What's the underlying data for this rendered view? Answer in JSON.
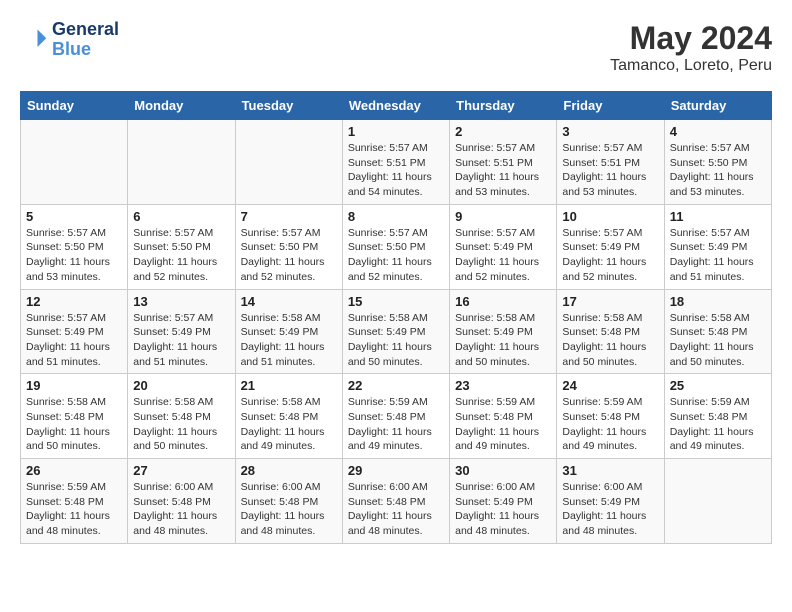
{
  "header": {
    "logo_line1": "General",
    "logo_line2": "Blue",
    "title": "May 2024",
    "subtitle": "Tamanco, Loreto, Peru"
  },
  "days_of_week": [
    "Sunday",
    "Monday",
    "Tuesday",
    "Wednesday",
    "Thursday",
    "Friday",
    "Saturday"
  ],
  "weeks": [
    [
      {
        "num": "",
        "info": ""
      },
      {
        "num": "",
        "info": ""
      },
      {
        "num": "",
        "info": ""
      },
      {
        "num": "1",
        "info": "Sunrise: 5:57 AM\nSunset: 5:51 PM\nDaylight: 11 hours\nand 54 minutes."
      },
      {
        "num": "2",
        "info": "Sunrise: 5:57 AM\nSunset: 5:51 PM\nDaylight: 11 hours\nand 53 minutes."
      },
      {
        "num": "3",
        "info": "Sunrise: 5:57 AM\nSunset: 5:51 PM\nDaylight: 11 hours\nand 53 minutes."
      },
      {
        "num": "4",
        "info": "Sunrise: 5:57 AM\nSunset: 5:50 PM\nDaylight: 11 hours\nand 53 minutes."
      }
    ],
    [
      {
        "num": "5",
        "info": "Sunrise: 5:57 AM\nSunset: 5:50 PM\nDaylight: 11 hours\nand 53 minutes."
      },
      {
        "num": "6",
        "info": "Sunrise: 5:57 AM\nSunset: 5:50 PM\nDaylight: 11 hours\nand 52 minutes."
      },
      {
        "num": "7",
        "info": "Sunrise: 5:57 AM\nSunset: 5:50 PM\nDaylight: 11 hours\nand 52 minutes."
      },
      {
        "num": "8",
        "info": "Sunrise: 5:57 AM\nSunset: 5:50 PM\nDaylight: 11 hours\nand 52 minutes."
      },
      {
        "num": "9",
        "info": "Sunrise: 5:57 AM\nSunset: 5:49 PM\nDaylight: 11 hours\nand 52 minutes."
      },
      {
        "num": "10",
        "info": "Sunrise: 5:57 AM\nSunset: 5:49 PM\nDaylight: 11 hours\nand 52 minutes."
      },
      {
        "num": "11",
        "info": "Sunrise: 5:57 AM\nSunset: 5:49 PM\nDaylight: 11 hours\nand 51 minutes."
      }
    ],
    [
      {
        "num": "12",
        "info": "Sunrise: 5:57 AM\nSunset: 5:49 PM\nDaylight: 11 hours\nand 51 minutes."
      },
      {
        "num": "13",
        "info": "Sunrise: 5:57 AM\nSunset: 5:49 PM\nDaylight: 11 hours\nand 51 minutes."
      },
      {
        "num": "14",
        "info": "Sunrise: 5:58 AM\nSunset: 5:49 PM\nDaylight: 11 hours\nand 51 minutes."
      },
      {
        "num": "15",
        "info": "Sunrise: 5:58 AM\nSunset: 5:49 PM\nDaylight: 11 hours\nand 50 minutes."
      },
      {
        "num": "16",
        "info": "Sunrise: 5:58 AM\nSunset: 5:49 PM\nDaylight: 11 hours\nand 50 minutes."
      },
      {
        "num": "17",
        "info": "Sunrise: 5:58 AM\nSunset: 5:48 PM\nDaylight: 11 hours\nand 50 minutes."
      },
      {
        "num": "18",
        "info": "Sunrise: 5:58 AM\nSunset: 5:48 PM\nDaylight: 11 hours\nand 50 minutes."
      }
    ],
    [
      {
        "num": "19",
        "info": "Sunrise: 5:58 AM\nSunset: 5:48 PM\nDaylight: 11 hours\nand 50 minutes."
      },
      {
        "num": "20",
        "info": "Sunrise: 5:58 AM\nSunset: 5:48 PM\nDaylight: 11 hours\nand 50 minutes."
      },
      {
        "num": "21",
        "info": "Sunrise: 5:58 AM\nSunset: 5:48 PM\nDaylight: 11 hours\nand 49 minutes."
      },
      {
        "num": "22",
        "info": "Sunrise: 5:59 AM\nSunset: 5:48 PM\nDaylight: 11 hours\nand 49 minutes."
      },
      {
        "num": "23",
        "info": "Sunrise: 5:59 AM\nSunset: 5:48 PM\nDaylight: 11 hours\nand 49 minutes."
      },
      {
        "num": "24",
        "info": "Sunrise: 5:59 AM\nSunset: 5:48 PM\nDaylight: 11 hours\nand 49 minutes."
      },
      {
        "num": "25",
        "info": "Sunrise: 5:59 AM\nSunset: 5:48 PM\nDaylight: 11 hours\nand 49 minutes."
      }
    ],
    [
      {
        "num": "26",
        "info": "Sunrise: 5:59 AM\nSunset: 5:48 PM\nDaylight: 11 hours\nand 48 minutes."
      },
      {
        "num": "27",
        "info": "Sunrise: 6:00 AM\nSunset: 5:48 PM\nDaylight: 11 hours\nand 48 minutes."
      },
      {
        "num": "28",
        "info": "Sunrise: 6:00 AM\nSunset: 5:48 PM\nDaylight: 11 hours\nand 48 minutes."
      },
      {
        "num": "29",
        "info": "Sunrise: 6:00 AM\nSunset: 5:48 PM\nDaylight: 11 hours\nand 48 minutes."
      },
      {
        "num": "30",
        "info": "Sunrise: 6:00 AM\nSunset: 5:49 PM\nDaylight: 11 hours\nand 48 minutes."
      },
      {
        "num": "31",
        "info": "Sunrise: 6:00 AM\nSunset: 5:49 PM\nDaylight: 11 hours\nand 48 minutes."
      },
      {
        "num": "",
        "info": ""
      }
    ]
  ]
}
